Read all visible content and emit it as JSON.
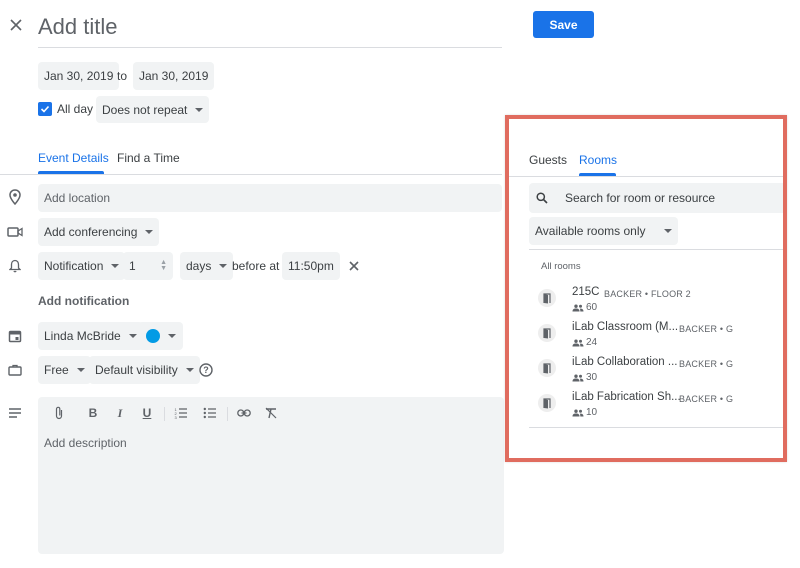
{
  "title_placeholder": "Add title",
  "save_label": "Save",
  "dates": {
    "start": "Jan 30, 2019",
    "to": "to",
    "end": "Jan 30, 2019"
  },
  "allday": {
    "label": "All day",
    "checked": true
  },
  "repeat": "Does not repeat",
  "tabs": {
    "event_details": "Event Details",
    "find_time": "Find a Time"
  },
  "location_placeholder": "Add location",
  "conferencing": "Add conferencing",
  "notification": {
    "type": "Notification",
    "value": "1",
    "unit": "days",
    "before_at": "before at",
    "time": "11:50pm"
  },
  "add_notification": "Add notification",
  "calendar_owner": "Linda McBride",
  "event_color": "#039be5",
  "availability": "Free",
  "visibility": "Default visibility",
  "description_placeholder": "Add description",
  "side_tabs": {
    "guests": "Guests",
    "rooms": "Rooms"
  },
  "room_search_placeholder": "Search for room or resource",
  "room_filter": "Available rooms only",
  "rooms_heading": "All rooms",
  "rooms": [
    {
      "name": "215C",
      "location": "BACKER • FLOOR 2",
      "capacity": "60"
    },
    {
      "name": "iLab Classroom (M...",
      "location": "BACKER • G",
      "capacity": "24"
    },
    {
      "name": "iLab Collaboration ...",
      "location": "BACKER • G",
      "capacity": "30"
    },
    {
      "name": "iLab Fabrication Sh...",
      "location": "BACKER • G",
      "capacity": "10"
    }
  ],
  "colors": {
    "accent": "#1a73e8",
    "highlight_border": "#e06c5f"
  }
}
